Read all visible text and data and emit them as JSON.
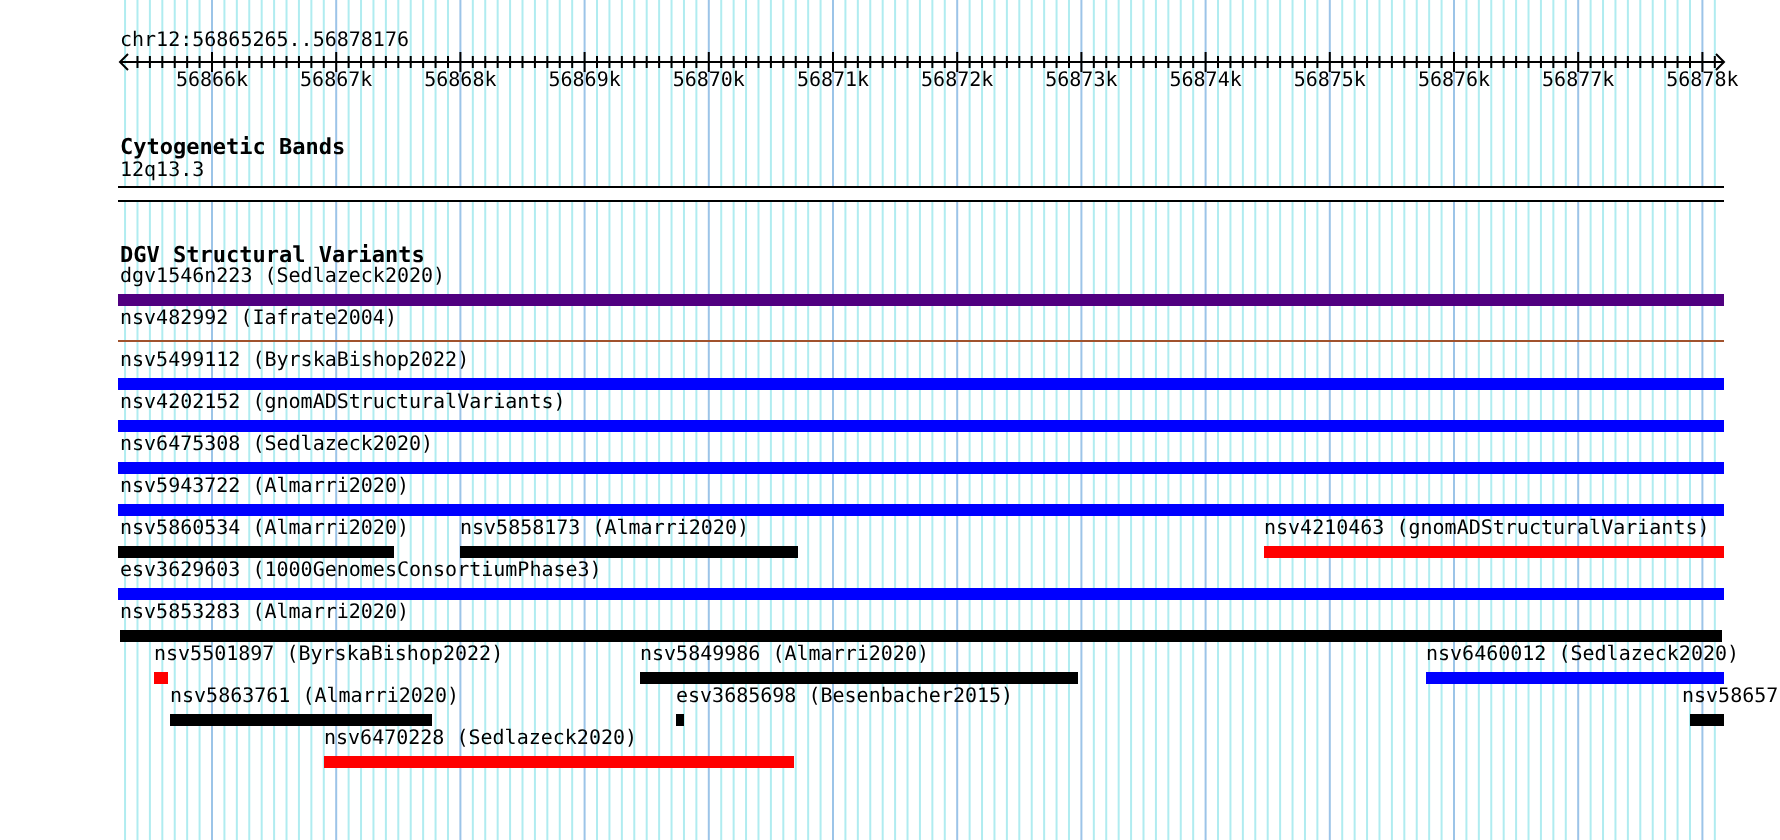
{
  "location": "chr12:56865265..56878176",
  "ruler": {
    "ticks": [
      "56866k",
      "56867k",
      "56868k",
      "56869k",
      "56870k",
      "56871k",
      "56872k",
      "56873k",
      "56874k",
      "56875k",
      "56876k",
      "56877k",
      "56878k"
    ]
  },
  "tracks": [
    {
      "title": "Cytogenetic Bands",
      "kind": "bands",
      "features": [
        {
          "label": "12q13.3"
        }
      ]
    },
    {
      "title": "DGV Structural Variants",
      "kind": "variants",
      "features": [
        {
          "label": "dgv1546n223 (Sedlazeck2020)",
          "kind": "bar",
          "color": "#500080"
        },
        {
          "label": "nsv482992 (Iafrate2004)",
          "kind": "line",
          "color": "#a0522d"
        },
        {
          "label": "nsv5499112 (ByrskaBishop2022)",
          "kind": "bar",
          "color": "#0000ff"
        },
        {
          "label": "nsv4202152 (gnomADStructuralVariants)",
          "kind": "bar",
          "color": "#0000ff"
        },
        {
          "label": "nsv6475308 (Sedlazeck2020)",
          "kind": "bar",
          "color": "#0000ff"
        },
        {
          "label": "nsv5943722 (Almarri2020)",
          "kind": "bar",
          "color": "#0000ff"
        },
        {
          "label": "nsv5860534 (Almarri2020)",
          "kind": "bar",
          "color": "#000000"
        },
        {
          "label": "nsv5858173 (Almarri2020)",
          "kind": "bar",
          "color": "#000000"
        },
        {
          "label": "nsv4210463 (gnomADStructuralVariants)",
          "kind": "bar",
          "color": "#ff0000"
        },
        {
          "label": "esv3629603 (1000GenomesConsortiumPhase3)",
          "kind": "bar",
          "color": "#0000ff"
        },
        {
          "label": "nsv5853283 (Almarri2020)",
          "kind": "bar",
          "color": "#000000"
        },
        {
          "label": "nsv5501897 (ByrskaBishop2022)",
          "kind": "bar",
          "color": "#ff0000"
        },
        {
          "label": "nsv5849986 (Almarri2020)",
          "kind": "bar",
          "color": "#000000"
        },
        {
          "label": "nsv6460012 (Sedlazeck2020)",
          "kind": "bar",
          "color": "#0000ff"
        },
        {
          "label": "nsv5863761 (Almarri2020)",
          "kind": "bar",
          "color": "#000000"
        },
        {
          "label": "esv3685698 (Besenbacher2015)",
          "kind": "bar",
          "color": "#000000"
        },
        {
          "label": "nsv58657",
          "kind": "bar",
          "color": "#000000"
        },
        {
          "label": "nsv6470228 (Sedlazeck2020)",
          "kind": "bar",
          "color": "#ff0000"
        }
      ]
    }
  ]
}
